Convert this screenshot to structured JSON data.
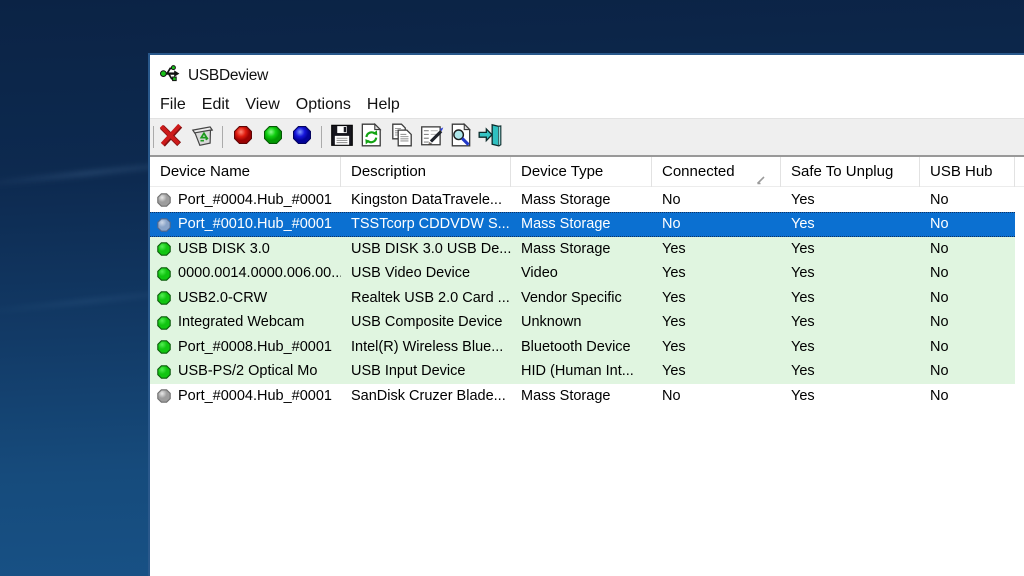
{
  "window": {
    "title": "USBDeview",
    "app_icon": "usb-logo-icon"
  },
  "menu": {
    "items": [
      {
        "label": "File"
      },
      {
        "label": "Edit"
      },
      {
        "label": "View"
      },
      {
        "label": "Options"
      },
      {
        "label": "Help"
      }
    ]
  },
  "toolbar": {
    "items": [
      {
        "divider": true
      },
      {
        "name": "uninstall-device-button",
        "icon": "red-x-icon"
      },
      {
        "name": "remove-device-button",
        "icon": "trash-recycle-icon"
      },
      {
        "divider": true
      },
      {
        "name": "red-ball-button",
        "icon": "red-ball-icon"
      },
      {
        "name": "green-ball-button",
        "icon": "green-ball-icon"
      },
      {
        "name": "blue-ball-button",
        "icon": "blue-ball-icon"
      },
      {
        "divider": true
      },
      {
        "name": "save-button",
        "icon": "save-floppy-icon"
      },
      {
        "name": "refresh-button",
        "icon": "refresh-icon"
      },
      {
        "name": "copy-button",
        "icon": "copy-icon"
      },
      {
        "name": "properties-button",
        "icon": "properties-icon"
      },
      {
        "name": "find-button",
        "icon": "find-icon"
      },
      {
        "name": "exit-button",
        "icon": "exit-door-icon"
      }
    ]
  },
  "table": {
    "columns": [
      {
        "label": "Device Name"
      },
      {
        "label": "Description"
      },
      {
        "label": "Device Type"
      },
      {
        "label": "Connected",
        "sort": "asc"
      },
      {
        "label": "Safe To Unplug"
      },
      {
        "label": "USB Hub"
      }
    ],
    "rows": [
      {
        "icon": "gray",
        "state": "plain",
        "name": "Port_#0004.Hub_#0001",
        "description": "Kingston DataTravele...",
        "device_type": "Mass Storage",
        "connected": "No",
        "safe_to_unplug": "Yes",
        "usb_hub": "No"
      },
      {
        "icon": "gray",
        "state": "selected",
        "name": "Port_#0010.Hub_#0001",
        "description": "TSSTcorp CDDVDW S...",
        "device_type": "Mass Storage",
        "connected": "No",
        "safe_to_unplug": "Yes",
        "usb_hub": "No"
      },
      {
        "icon": "green",
        "state": "connected",
        "name": "USB DISK 3.0",
        "description": "USB DISK 3.0 USB De...",
        "device_type": "Mass Storage",
        "connected": "Yes",
        "safe_to_unplug": "Yes",
        "usb_hub": "No"
      },
      {
        "icon": "green",
        "state": "connected",
        "name": "0000.0014.0000.006.00...",
        "description": "USB Video Device",
        "device_type": "Video",
        "connected": "Yes",
        "safe_to_unplug": "Yes",
        "usb_hub": "No"
      },
      {
        "icon": "green",
        "state": "connected",
        "name": "USB2.0-CRW",
        "description": "Realtek USB 2.0 Card ...",
        "device_type": "Vendor Specific",
        "connected": "Yes",
        "safe_to_unplug": "Yes",
        "usb_hub": "No"
      },
      {
        "icon": "green",
        "state": "connected",
        "name": "Integrated Webcam",
        "description": "USB Composite Device",
        "device_type": "Unknown",
        "connected": "Yes",
        "safe_to_unplug": "Yes",
        "usb_hub": "No"
      },
      {
        "icon": "green",
        "state": "connected",
        "name": "Port_#0008.Hub_#0001",
        "description": "Intel(R) Wireless Blue...",
        "device_type": "Bluetooth Device",
        "connected": "Yes",
        "safe_to_unplug": "Yes",
        "usb_hub": "No"
      },
      {
        "icon": "green",
        "state": "connected",
        "name": "USB-PS/2 Optical Mo",
        "description": "USB Input Device",
        "device_type": "HID (Human Int...",
        "connected": "Yes",
        "safe_to_unplug": "Yes",
        "usb_hub": "No"
      },
      {
        "icon": "gray",
        "state": "plain",
        "name": "Port_#0004.Hub_#0001",
        "description": "SanDisk Cruzer Blade...",
        "device_type": "Mass Storage",
        "connected": "No",
        "safe_to_unplug": "Yes",
        "usb_hub": "No"
      }
    ]
  },
  "colors": {
    "selection_blue": "#0b70d1",
    "connected_green_row": "#e0f5e0",
    "toolbar_gray": "#efefef",
    "window_border_blue": "#29588b",
    "desktop_navy_top": "#0b2345",
    "desktop_blue_bottom": "#195589"
  }
}
